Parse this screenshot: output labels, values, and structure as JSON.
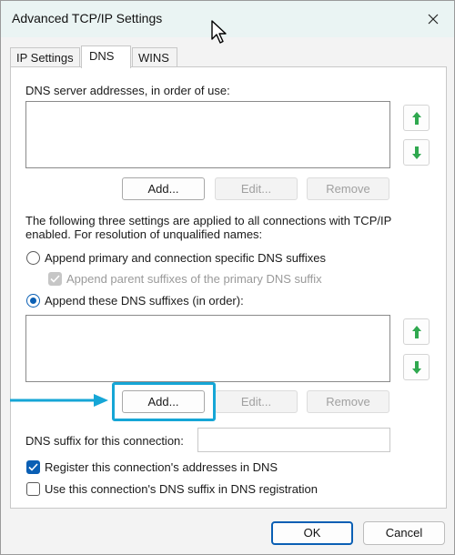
{
  "window": {
    "title": "Advanced TCP/IP Settings"
  },
  "tabs": [
    {
      "label": "IP Settings",
      "active": false
    },
    {
      "label": "DNS",
      "active": true
    },
    {
      "label": "WINS",
      "active": false
    }
  ],
  "dns_servers": {
    "label": "DNS server addresses, in order of use:",
    "items": [],
    "buttons": {
      "add": "Add...",
      "edit": "Edit...",
      "remove": "Remove"
    },
    "buttons_enabled": {
      "add": true,
      "edit": false,
      "remove": false
    }
  },
  "resolution": {
    "description": "The following three settings are applied to all connections with TCP/IP enabled. For resolution of unqualified names:",
    "description_line1": "The following three settings are applied to all connections with TCP/IP",
    "description_line2": "enabled. For resolution of unqualified names:",
    "option_primary": {
      "label": "Append primary and connection specific DNS suffixes",
      "selected": false
    },
    "option_parent": {
      "label": "Append parent suffixes of the primary DNS suffix",
      "checked": true,
      "enabled": false
    },
    "option_these": {
      "label": "Append these DNS suffixes (in order):",
      "selected": true
    }
  },
  "suffixes": {
    "items": [],
    "buttons": {
      "add": "Add...",
      "edit": "Edit...",
      "remove": "Remove"
    },
    "buttons_enabled": {
      "add": true,
      "edit": false,
      "remove": false
    }
  },
  "connection_suffix": {
    "label": "DNS suffix for this connection:",
    "value": ""
  },
  "register_addresses": {
    "label": "Register this connection's addresses in DNS",
    "checked": true
  },
  "use_suffix_registration": {
    "label": "Use this connection's DNS suffix in DNS registration",
    "checked": false
  },
  "footer": {
    "ok": "OK",
    "cancel": "Cancel"
  },
  "colors": {
    "accent": "#0a5fb4",
    "highlight": "#16a6d6",
    "titlebar": "#eaf4f3",
    "arrow_green": "#2fa84f"
  }
}
